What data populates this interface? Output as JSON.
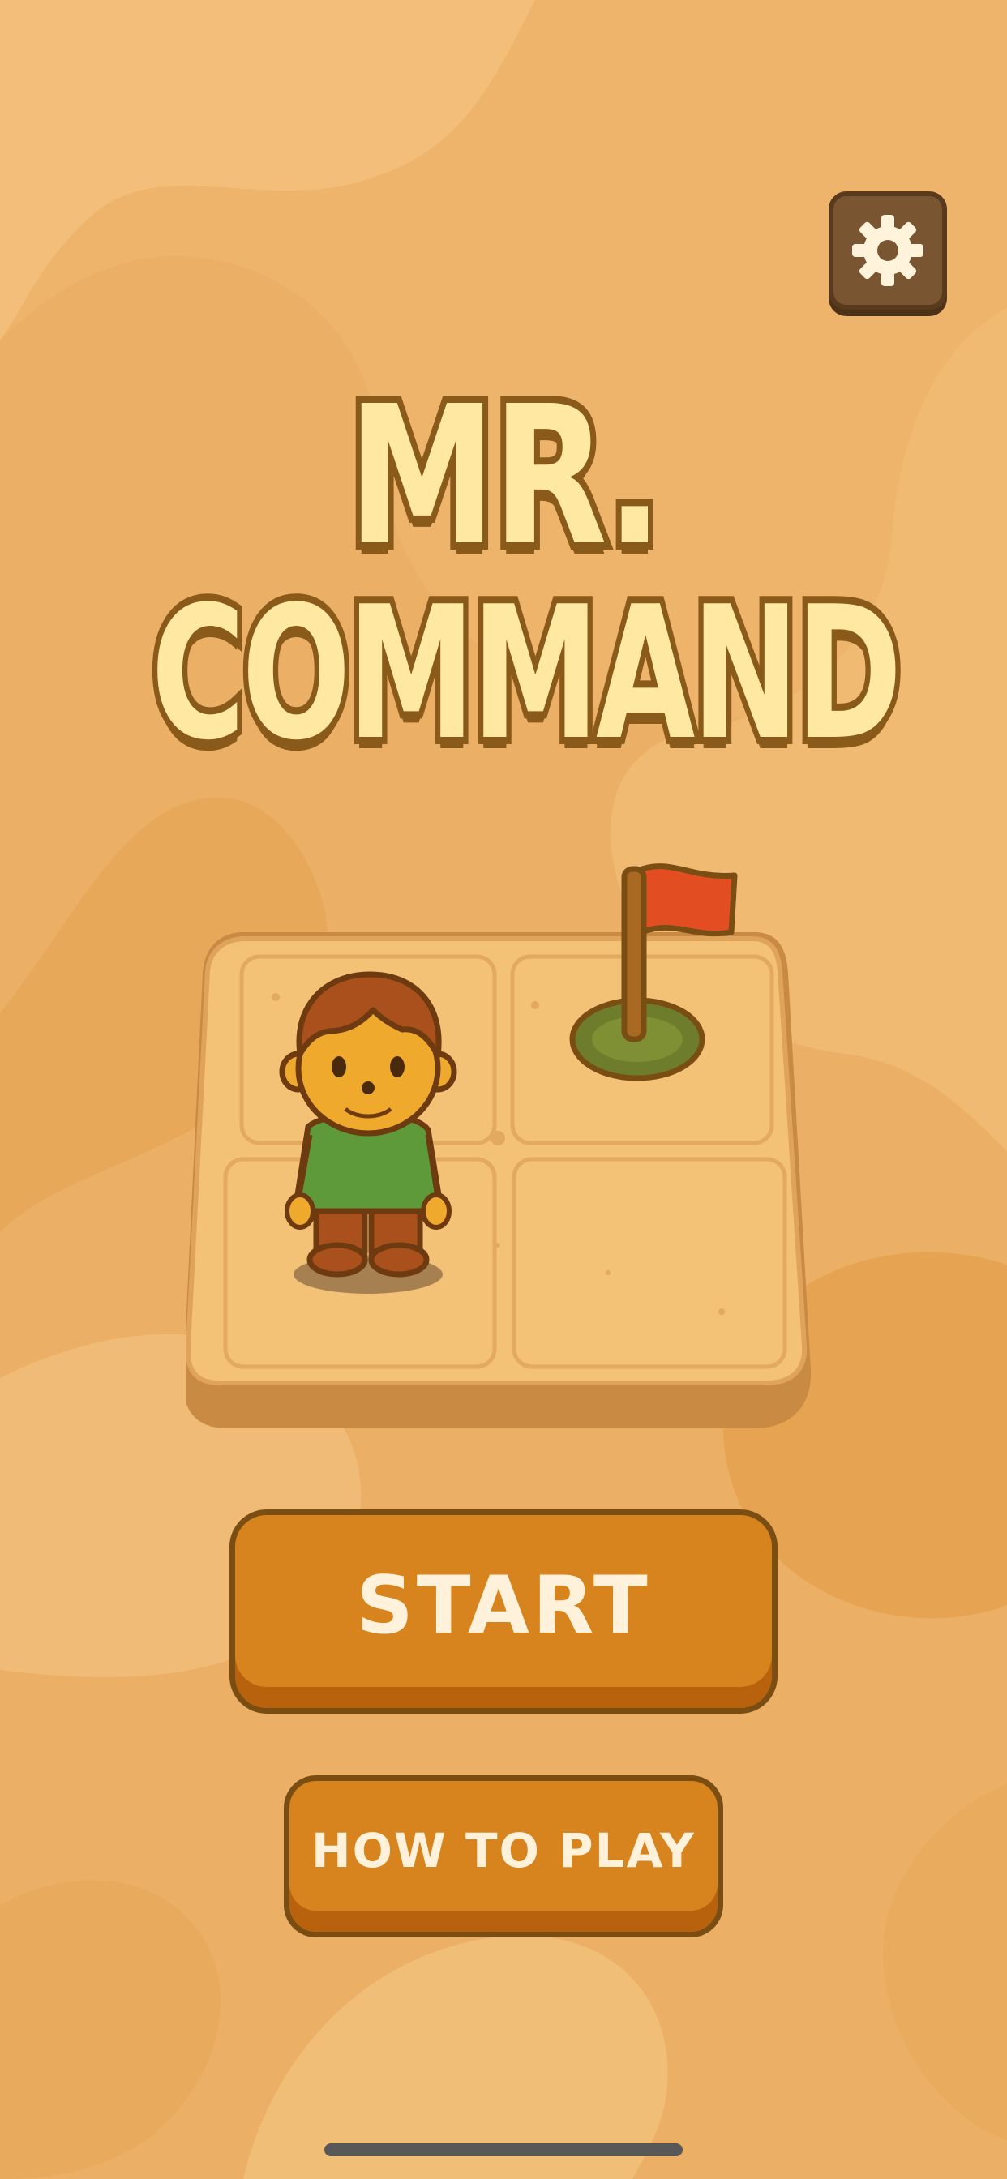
{
  "colors": {
    "background": "#EBB066",
    "title_fill": "#FFE9A2",
    "title_outline": "#8A5A1A",
    "button_fill": "#D7831E",
    "button_outline": "#7A4E12",
    "button_text": "#FFF1DA",
    "settings_fill": "#7A5532",
    "flag": "#E24E21",
    "shirt": "#5E9A3A"
  },
  "header": {
    "settings_icon": "gear-icon"
  },
  "title": {
    "line1": "MR.",
    "line2": "COMMAND"
  },
  "board": {
    "grid": "2x2",
    "character": "player-character",
    "goal": "flag"
  },
  "menu": {
    "start_label": "START",
    "how_to_play_label": "HOW TO PLAY"
  }
}
